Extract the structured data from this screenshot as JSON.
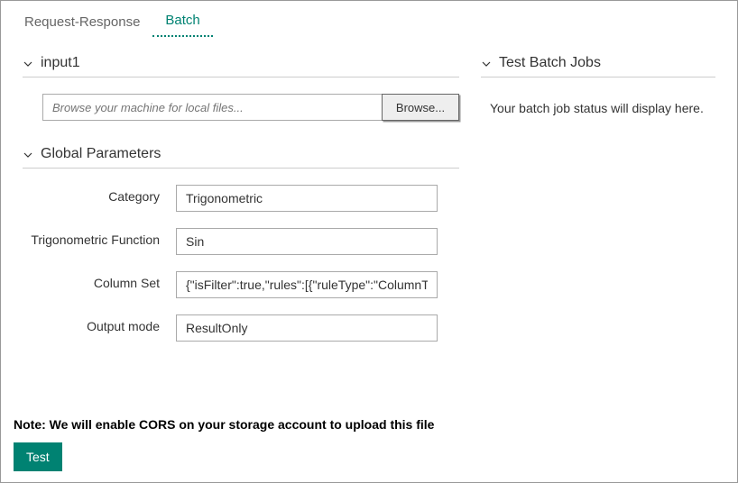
{
  "tabs": {
    "request_response": "Request-Response",
    "batch": "Batch"
  },
  "sections": {
    "input1": "input1",
    "global_params": "Global Parameters",
    "test_batch": "Test Batch Jobs"
  },
  "file": {
    "placeholder": "Browse your machine for local files...",
    "browse_label": "Browse..."
  },
  "params": {
    "category": {
      "label": "Category",
      "value": "Trigonometric"
    },
    "trig_func": {
      "label": "Trigonometric Function",
      "value": "Sin"
    },
    "column_set": {
      "label": "Column Set",
      "value": "{\"isFilter\":true,\"rules\":[{\"ruleType\":\"ColumnTyp"
    },
    "output_mode": {
      "label": "Output mode",
      "value": "ResultOnly"
    }
  },
  "note": "Note: We will enable CORS on your storage account to upload this file",
  "test_button": "Test",
  "batch_status": "Your batch job status will display here."
}
